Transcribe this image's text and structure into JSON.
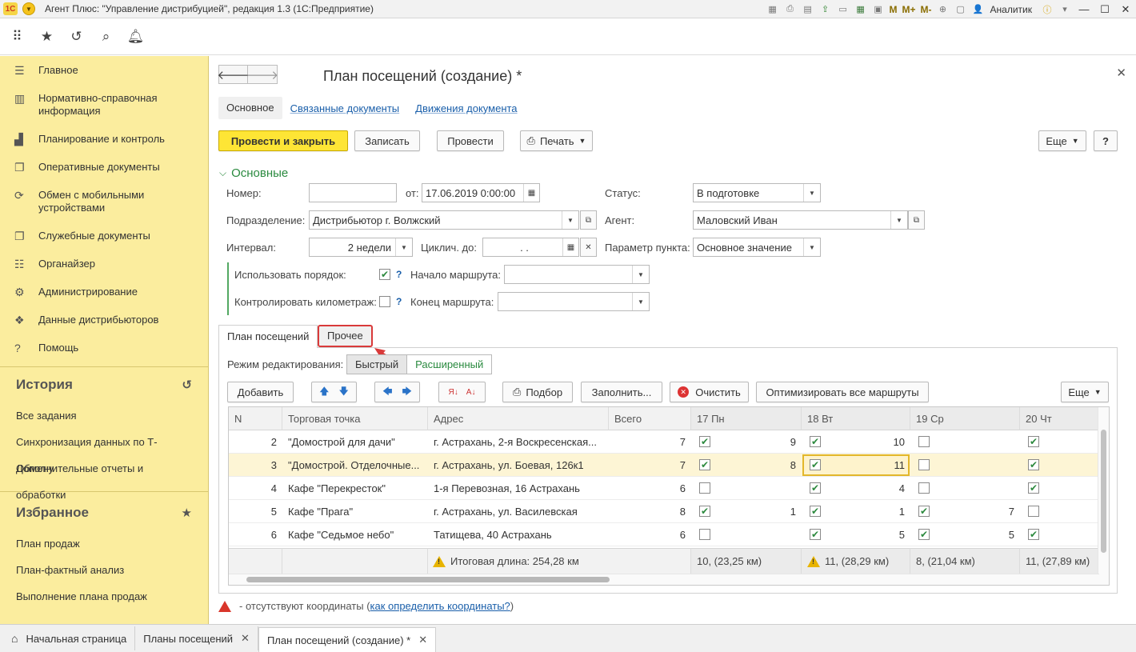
{
  "window": {
    "title": "Агент Плюс: \"Управление дистрибуцией\", редакция 1.3  (1С:Предприятие)",
    "logo": "1С",
    "user": "Аналитик",
    "memory_buttons": [
      "M",
      "M+",
      "M-"
    ]
  },
  "sidebar": {
    "items": [
      {
        "label": "Главное",
        "icon": "list-icon"
      },
      {
        "label": "Нормативно-справочная информация",
        "icon": "books-icon"
      },
      {
        "label": "Планирование и контроль",
        "icon": "bar-chart-icon"
      },
      {
        "label": "Оперативные документы",
        "icon": "documents-icon"
      },
      {
        "label": "Обмен с мобильными устройствами",
        "icon": "sync-icon"
      },
      {
        "label": "Служебные документы",
        "icon": "documents-icon"
      },
      {
        "label": "Органайзер",
        "icon": "organizer-icon"
      },
      {
        "label": "Администрирование",
        "icon": "gear-icon"
      },
      {
        "label": "Данные дистрибьюторов",
        "icon": "distributor-icon"
      },
      {
        "label": "Помощь",
        "icon": "help-icon"
      }
    ],
    "history": {
      "title": "История",
      "links": [
        "Все задания",
        "Синхронизация данных по Т-Обмену",
        "Дополнительные отчеты и обработки"
      ]
    },
    "favorites": {
      "title": "Избранное",
      "links": [
        "План продаж",
        "План-фактный анализ",
        "Выполнение плана продаж"
      ]
    }
  },
  "form": {
    "title": "План посещений  (создание) *",
    "tabs": [
      "Основное",
      "Связанные документы",
      "Движения документа"
    ],
    "buttons": {
      "post_close": "Провести и закрыть",
      "save": "Записать",
      "post": "Провести",
      "print": "Печать",
      "more": "Еще",
      "help": "?"
    },
    "group_title": "Основные",
    "fields": {
      "number_label": "Номер:",
      "number_value": "",
      "date_label": "от:",
      "date_value": "17.06.2019  0:00:00",
      "status_label": "Статус:",
      "status_value": "В подготовке",
      "division_label": "Подразделение:",
      "division_value": "Дистрибьютор г. Волжский",
      "agent_label": "Агент:",
      "agent_value": "Маловский Иван",
      "interval_label": "Интервал:",
      "interval_value": "2 недели",
      "cyclic_label": "Циклич. до:",
      "cyclic_value": ".   .",
      "param_label": "Параметр пункта:",
      "param_value": "Основное значение",
      "use_order_label": "Использовать порядок:",
      "route_start_label": "Начало маршрута:",
      "mileage_label": "Контролировать километраж:",
      "route_end_label": "Конец маршрута:"
    },
    "inner_tabs": [
      "План посещений",
      "Прочее"
    ],
    "edit_mode_label": "Режим редактирования:",
    "edit_modes": [
      "Быстрый",
      "Расширенный"
    ],
    "table_buttons": {
      "add": "Добавить",
      "pick": "Подбор",
      "fill": "Заполнить...",
      "clear": "Очистить",
      "optimize": "Оптимизировать все маршруты",
      "more": "Еще"
    },
    "table": {
      "columns": [
        "N",
        "Торговая точка",
        "Адрес",
        "Всего",
        "17 Пн",
        "18 Вт",
        "19 Ср",
        "20 Чт"
      ],
      "rows": [
        {
          "n": "2",
          "point": "\"Домострой для дачи\"",
          "address": "г. Астрахань, 2-я Воскресенская...",
          "total": "7",
          "d1c": true,
          "d1v": "9",
          "d2c": true,
          "d2v": "10",
          "d3c": false,
          "d3v": "",
          "d4c": true
        },
        {
          "n": "3",
          "point": "\"Домострой. Отделочные...",
          "address": "г. Астрахань, ул. Боевая, 126к1",
          "total": "7",
          "d1c": true,
          "d1v": "8",
          "d2c": true,
          "d2v": "11",
          "d3c": false,
          "d3v": "",
          "d4c": true
        },
        {
          "n": "4",
          "point": "Кафе \"Перекресток\"",
          "address": "1-я Перевозная, 16 Астрахань",
          "total": "6",
          "d1c": false,
          "d1v": "",
          "d2c": true,
          "d2v": "4",
          "d3c": false,
          "d3v": "",
          "d4c": true
        },
        {
          "n": "5",
          "point": "Кафе \"Прага\"",
          "address": "г. Астрахань, ул. Василевская",
          "total": "8",
          "d1c": true,
          "d1v": "1",
          "d2c": true,
          "d2v": "1",
          "d3c": true,
          "d3v": "7",
          "d4c": false
        },
        {
          "n": "6",
          "point": "Кафе \"Седьмое небо\"",
          "address": "Татищева, 40 Астрахань",
          "total": "6",
          "d1c": false,
          "d1v": "",
          "d2c": true,
          "d2v": "5",
          "d3c": true,
          "d3v": "5",
          "d4c": true
        }
      ],
      "footer": {
        "total": "Итоговая длина: 254,28 км",
        "d1": "10, (23,25 км)",
        "d2": "11, (28,29 км)",
        "d3": "8, (21,04 км)",
        "d4": "11, (27,89 км)"
      }
    },
    "note": {
      "text": "- отсутствуют координаты (",
      "link": "как определить координаты?",
      "close": ")"
    }
  },
  "bottom_tabs": [
    "Начальная страница",
    "Планы посещений",
    "План посещений  (создание) *"
  ],
  "colors": {
    "accent_yellow": "#fee535",
    "sidebar": "#fbed9e",
    "green": "#2a8a3f",
    "link": "#1a5faa",
    "highlight": "#d93a3a"
  }
}
